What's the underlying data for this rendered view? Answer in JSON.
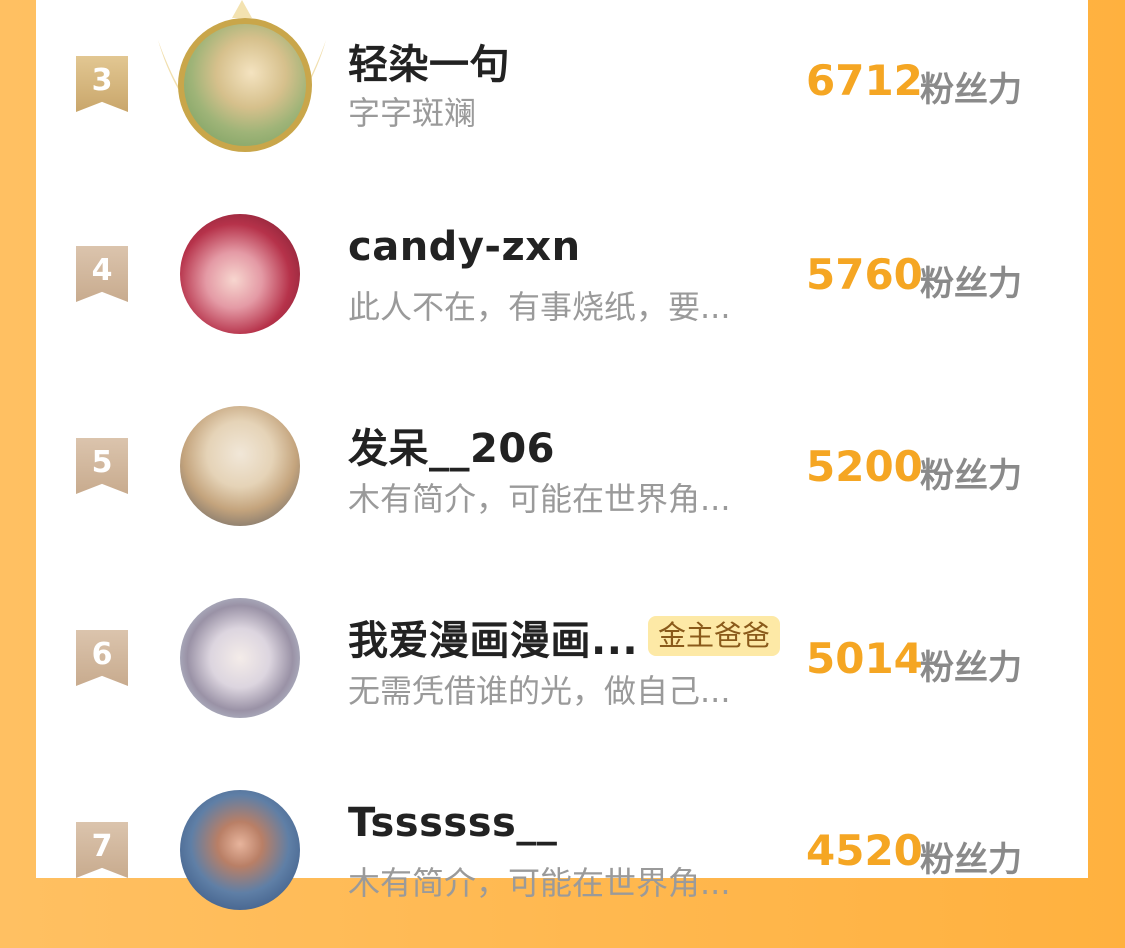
{
  "colors": {
    "accent": "#f5a623",
    "name": "#222222",
    "bio": "#9a9a9a",
    "unit": "#8a8a8a",
    "page_bg": "#ffb13f"
  },
  "rows": [
    {
      "rank": "3",
      "name": "轻染一句",
      "bio": "字字斑斓",
      "score": "6712",
      "unit": "粉丝力",
      "badge": ""
    },
    {
      "rank": "4",
      "name": "candy-zxn",
      "bio": "此人不在，有事烧纸，要...",
      "score": "5760",
      "unit": "粉丝力",
      "badge": ""
    },
    {
      "rank": "5",
      "name": "发呆__206",
      "bio": "木有简介，可能在世界角...",
      "score": "5200",
      "unit": "粉丝力",
      "badge": ""
    },
    {
      "rank": "6",
      "name": "我爱漫画漫画...",
      "bio": "无需凭借谁的光，做自己...",
      "score": "5014",
      "unit": "粉丝力",
      "badge": "金主爸爸"
    },
    {
      "rank": "7",
      "name": "Tssssss__",
      "bio": "木有简介，可能在世界角...",
      "score": "4520",
      "unit": "粉丝力",
      "badge": ""
    }
  ]
}
